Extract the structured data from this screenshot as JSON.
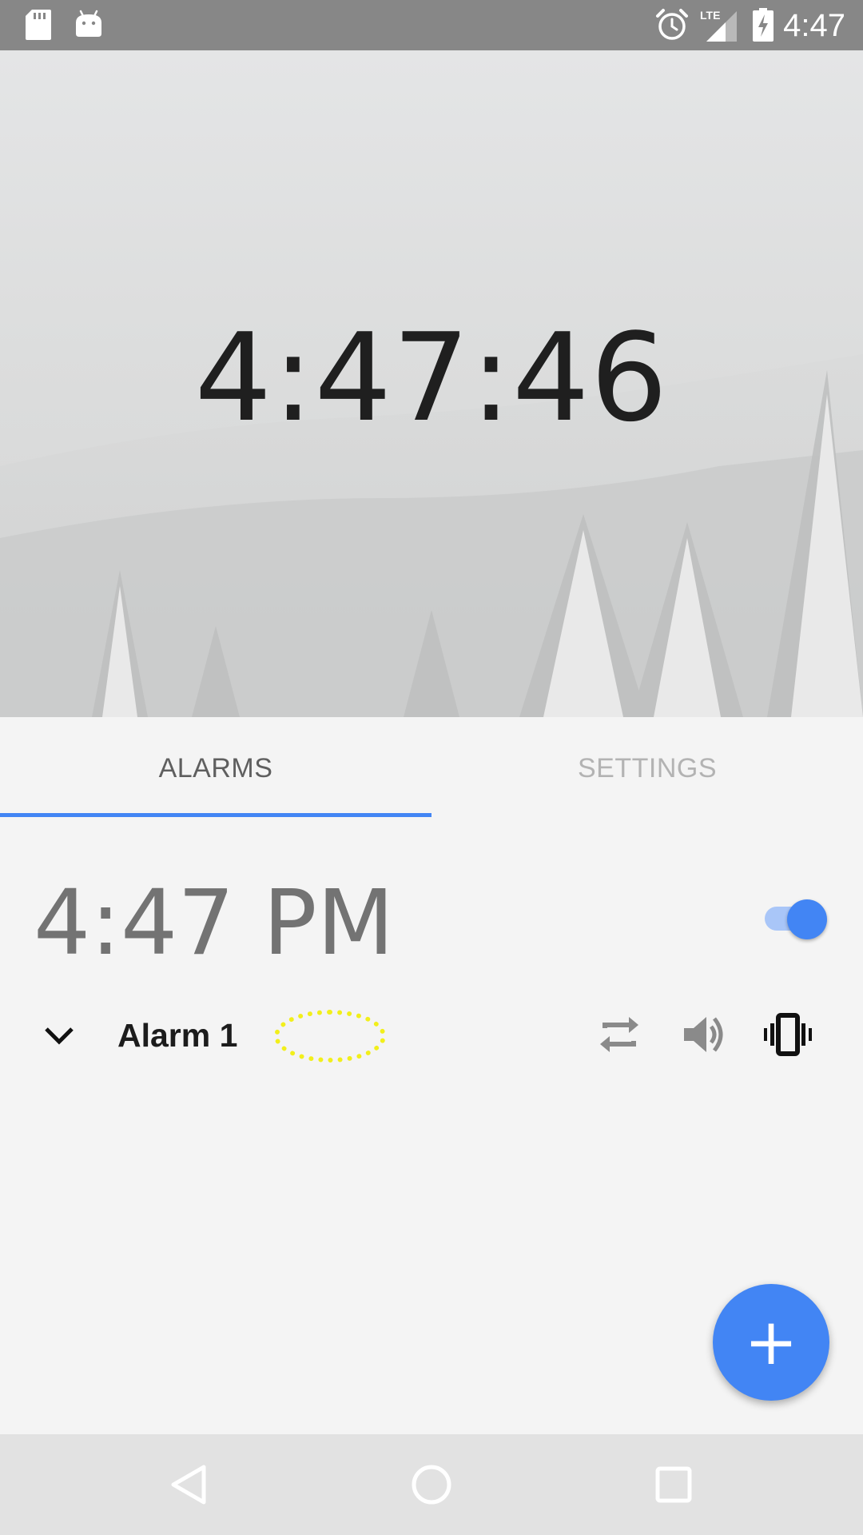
{
  "status_bar": {
    "time": "4:47",
    "icons": [
      "sd-card-icon",
      "android-icon",
      "alarm-clock-icon",
      "lte-signal-icon",
      "battery-charging-icon"
    ],
    "network": "LTE"
  },
  "hero": {
    "clock": "4:47:46"
  },
  "tabs": [
    {
      "label": "ALARMS",
      "selected": true
    },
    {
      "label": "SETTINGS",
      "selected": false
    }
  ],
  "alarm": {
    "time": "4:47 PM",
    "enabled": true,
    "label": "Alarm 1",
    "icons": [
      "expand-chevron-icon",
      "repeat-icon",
      "volume-icon",
      "vibrate-icon"
    ]
  },
  "fab": {
    "symbol": "+",
    "icon": "add-icon"
  },
  "nav_bar": {
    "icons": [
      "back-icon",
      "home-icon",
      "recents-icon"
    ]
  },
  "colors": {
    "accent": "#4285f4",
    "status_bar": "#878787",
    "highlight": "#f2ef1b"
  }
}
